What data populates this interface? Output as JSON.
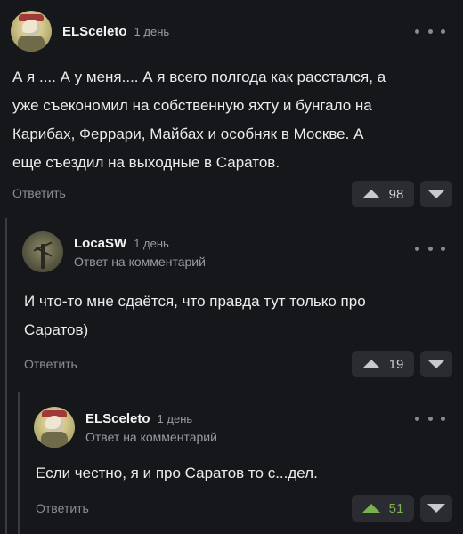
{
  "comments": [
    {
      "username": "ELSceleto",
      "time": "1 день",
      "text": "А я .... А у меня.... А я всего полгода как расстался, а\nуже съекономил на собственную яхту и бунгало на\nКарибах, Феррари, Майбах и особняк в Москве. А\nеще съездил на выходные в Саратов.",
      "reply_label": "Ответить",
      "votes": "98"
    },
    {
      "username": "LocaSW",
      "time": "1 день",
      "reply_to": "Ответ на комментарий",
      "text": "И что-то мне сдаётся, что правда тут только про\nСаратов)",
      "reply_label": "Ответить",
      "votes": "19"
    },
    {
      "username": "ELSceleto",
      "time": "1 день",
      "reply_to": "Ответ на комментарий",
      "text": "Если честно, я и про Саратов то с...дел.",
      "reply_label": "Ответить",
      "votes": "51"
    }
  ],
  "colors": {
    "background": "#16171a",
    "upvote_positive": "#79b24c"
  }
}
